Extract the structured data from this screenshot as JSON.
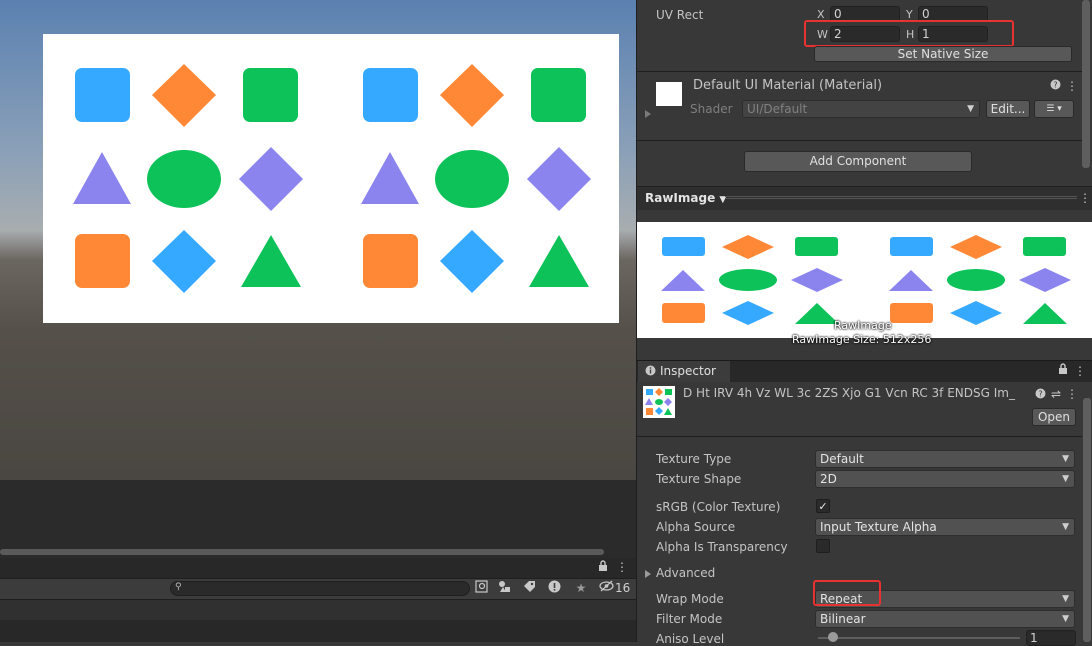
{
  "uv_rect": {
    "label": "UV Rect",
    "x_label": "X",
    "x_value": "0",
    "y_label": "Y",
    "y_value": "0",
    "w_label": "W",
    "w_value": "2",
    "h_label": "H",
    "h_value": "1",
    "set_native_size": "Set Native Size"
  },
  "material": {
    "title": "Default UI Material (Material)",
    "shader_label": "Shader",
    "shader_value": "UI/Default",
    "edit_button": "Edit...",
    "help_icon": "?",
    "menu_icon": "⋮"
  },
  "add_component": "Add Component",
  "preview": {
    "header": "RawImage",
    "caption": "RawImage",
    "size_caption": "RawImage Size: 512x256"
  },
  "inspector": {
    "tab": "Inspector",
    "asset_name": "D Ht IRV 4h Vz WL 3c 2ZS Xjo G1 Vcn RC 3f ENDSG Im_",
    "open_button": "Open",
    "rows": [
      {
        "label": "Texture Type",
        "value": "Default"
      },
      {
        "label": "Texture Shape",
        "value": "2D"
      },
      {
        "label": "sRGB (Color Texture)",
        "checked": true
      },
      {
        "label": "Alpha Source",
        "value": "Input Texture Alpha"
      },
      {
        "label": "Alpha Is Transparency",
        "checked": false
      },
      {
        "label": "Advanced"
      },
      {
        "label": "Wrap Mode",
        "value": "Repeat"
      },
      {
        "label": "Filter Mode",
        "value": "Bilinear"
      },
      {
        "label": "Aniso Level",
        "value": "1"
      }
    ]
  },
  "bottom_toolbar": {
    "search_placeholder": "",
    "hidden_count": "16"
  },
  "colors": {
    "blue": "#35a9ff",
    "orange": "#ff8836",
    "green": "#0cc259",
    "purple": "#8b84ef",
    "highlight": "#e8322f"
  }
}
